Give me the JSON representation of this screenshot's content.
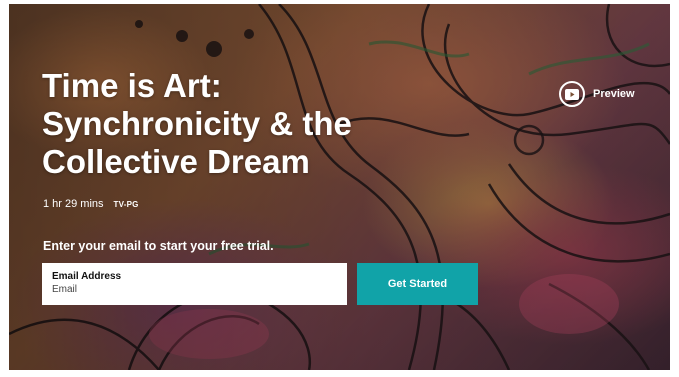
{
  "hero": {
    "title_lines": [
      "Time is Art:",
      "Synchronicity & the",
      "Collective Dream"
    ],
    "duration": "1 hr 29 mins",
    "rating": "TV-PG",
    "cta_text": "Enter your email to start your free trial."
  },
  "form": {
    "email_label": "Email Address",
    "email_placeholder": "Email",
    "submit_label": "Get Started"
  },
  "preview": {
    "label": "Preview",
    "icon": "play-icon"
  },
  "colors": {
    "accent": "#11a3a8",
    "text": "#ffffff"
  }
}
